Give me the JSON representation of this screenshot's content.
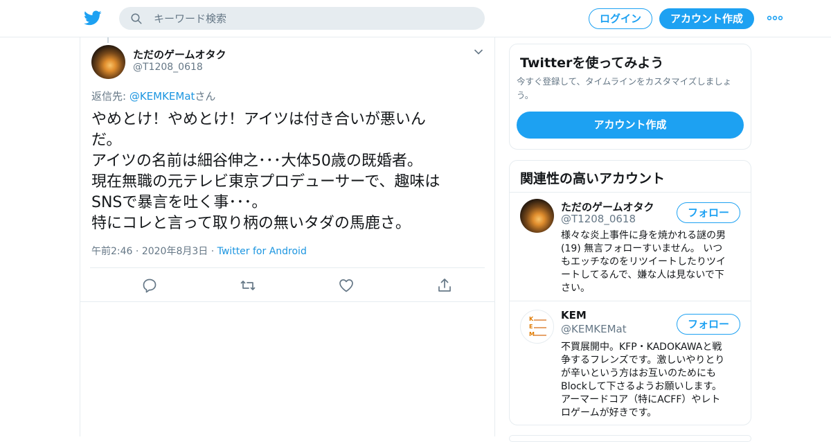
{
  "header": {
    "logo_icon": "twitter-bird-icon",
    "search_placeholder": "キーワード検索",
    "login_label": "ログイン",
    "signup_label": "アカウント作成",
    "more_icon": "more-dots-icon",
    "brand_color": "#1da1f2"
  },
  "tweet": {
    "author_name": "ただのゲームオタク",
    "author_handle": "@T1208_0618",
    "reply_prefix": "返信先: ",
    "reply_mention": "@KEMKEMat",
    "reply_suffix": "さん",
    "text_lines": [
      "やめとけ！やめとけ！アイツは付き合いが悪いん",
      "だ。",
      "アイツの名前は細谷伸之･･･大体50歳の既婚者。",
      "現在無職の元テレビ東京プロデューサーで、趣味は",
      "SNSで暴言を吐く事･･･。",
      "特にコレと言って取り柄の無いタダの馬鹿さ。"
    ],
    "time": "午前2:46",
    "sep": "·",
    "date": "2020年8月3日",
    "source": "Twitter for Android",
    "actions": [
      "reply-icon",
      "retweet-icon",
      "like-icon",
      "share-icon"
    ]
  },
  "sidebar": {
    "try_card": {
      "title": "Twitterを使ってみよう",
      "desc_line1": "今すぐ登録して、タイムラインをカスタマイズしましょ",
      "desc_line2": "う。",
      "button_label": "アカウント作成"
    },
    "related": {
      "title": "関連性の高いアカウント",
      "accounts": [
        {
          "name": "ただのゲームオタク",
          "handle": "@T1208_0618",
          "follow_label": "フォロー",
          "bio_lines": [
            "様々な炎上事件に身を焼かれる謎の男",
            "(19) 無言フォローすいません。 いつ",
            "もエッチなのをリツイートしたりツイ",
            "ートしてるんで、嫌な人は見ないで下",
            "さい。"
          ]
        },
        {
          "name": "KEM",
          "handle": "@KEMKEMat",
          "follow_label": "フォロー",
          "logo_letters": [
            "K",
            "E",
            "M"
          ],
          "bio_lines": [
            "不買展開中。KFP・KADOKAWAと戦",
            "争するフレンズです。激しいやりとり",
            "が辛いという方はお互いのためにも",
            "Blockして下さるようお願いします。",
            "アーマードコア（特にACFF）やレト",
            "ロゲームが好きです。"
          ]
        }
      ]
    }
  }
}
